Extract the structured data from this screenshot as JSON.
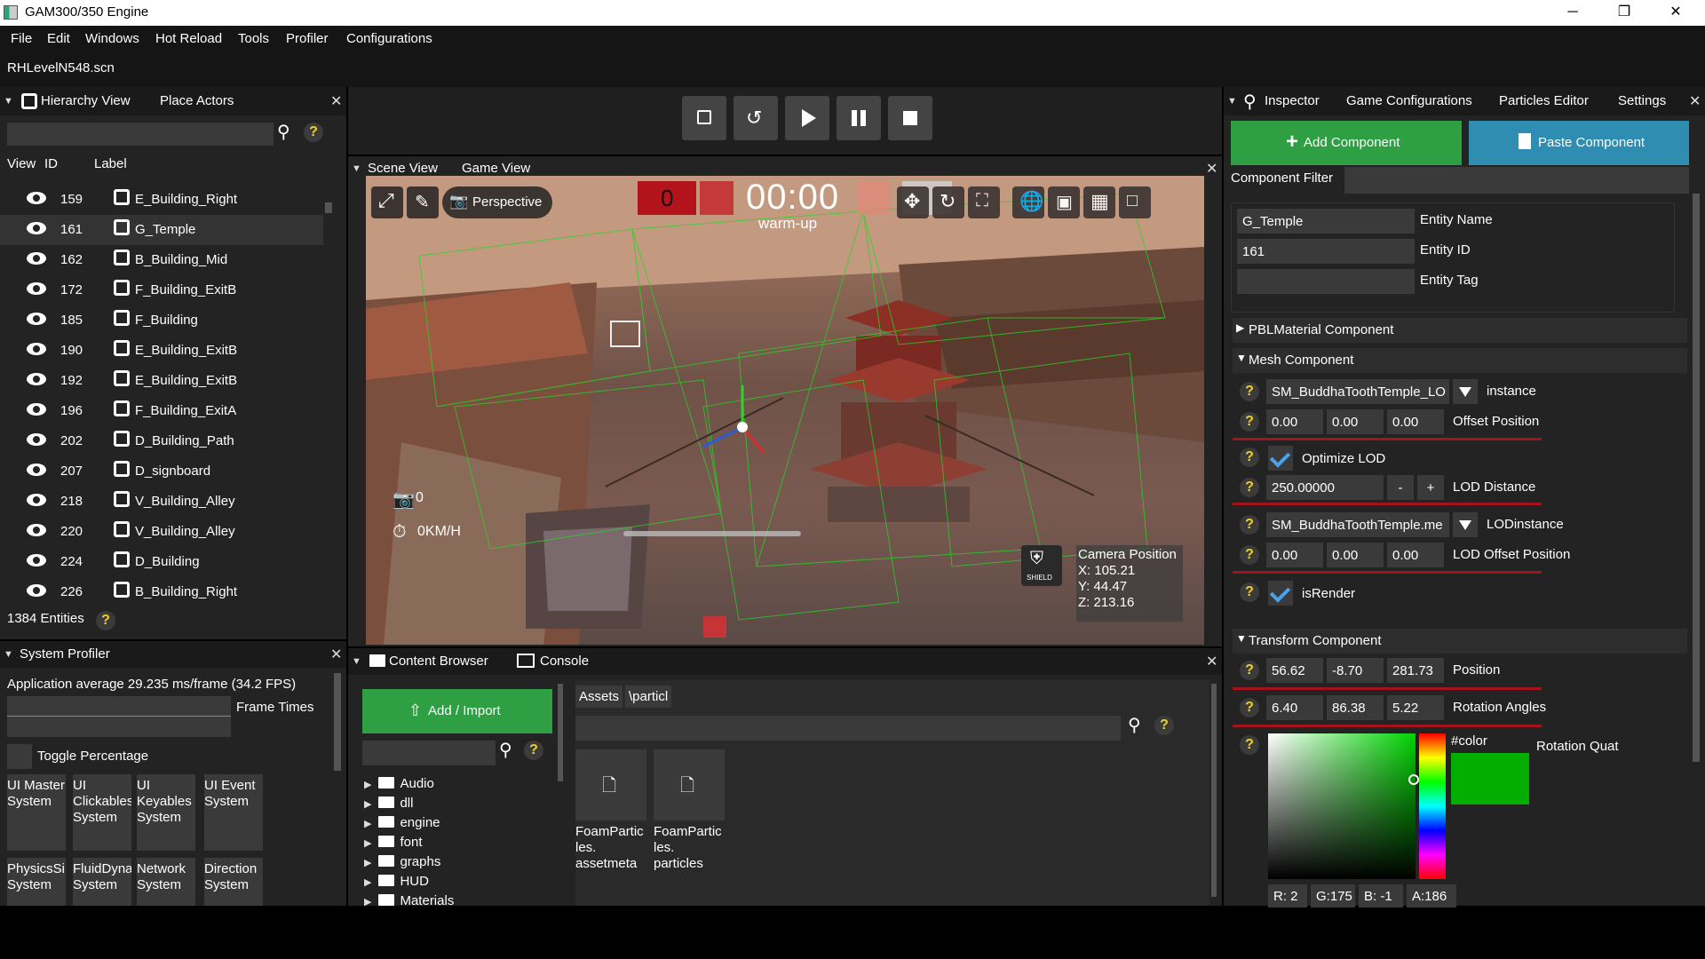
{
  "window": {
    "title": "GAM300/350 Engine",
    "minimize": "─",
    "maximize": "❐",
    "close": "✕"
  },
  "menu": [
    "File",
    "Edit",
    "Windows",
    "Hot Reload",
    "Tools",
    "Profiler",
    "Configurations"
  ],
  "scene_file": "RHLevelN548.scn",
  "hierarchy": {
    "tabs": [
      "Hierarchy View",
      "Place Actors"
    ],
    "columns": {
      "view": "View",
      "id": "ID",
      "label": "Label"
    },
    "rows": [
      {
        "id": "159",
        "label": "E_Building_Right"
      },
      {
        "id": "161",
        "label": "G_Temple"
      },
      {
        "id": "162",
        "label": "B_Building_Mid"
      },
      {
        "id": "172",
        "label": "F_Building_ExitB"
      },
      {
        "id": "185",
        "label": "F_Building"
      },
      {
        "id": "190",
        "label": "E_Building_ExitB"
      },
      {
        "id": "192",
        "label": "E_Building_ExitB"
      },
      {
        "id": "196",
        "label": "F_Building_ExitA"
      },
      {
        "id": "202",
        "label": "D_Building_Path"
      },
      {
        "id": "207",
        "label": "D_signboard"
      },
      {
        "id": "218",
        "label": "V_Building_Alley"
      },
      {
        "id": "220",
        "label": "V_Building_Alley"
      },
      {
        "id": "224",
        "label": "D_Building"
      },
      {
        "id": "226",
        "label": "B_Building_Right"
      }
    ],
    "entities_count": "1384 Entities"
  },
  "profiler": {
    "title": "System Profiler",
    "average": "Application average 29.235 ms/frame (34.2 FPS)",
    "frame_times": "Frame Times",
    "toggle": "Toggle Percentage",
    "systems": [
      "UI Master System",
      "UI Clickables System",
      "UI Keyables System",
      "UI Event System",
      "PhysicsSimulation System",
      "FluidDynamics System",
      "Network System",
      "Direction System"
    ]
  },
  "scene": {
    "tabs": [
      "Scene View",
      "Game View"
    ],
    "perspective": "Perspective",
    "score": "0",
    "timer": "00:00",
    "warmup": "warm-up",
    "camera_count": "0",
    "speed": "0KM/H",
    "shield": "SHIELD",
    "camera": {
      "title": "Camera Position",
      "x": "X: 105.21",
      "y": "Y: 44.47",
      "z": "Z: 213.16"
    }
  },
  "content": {
    "tabs": [
      "Content Browser",
      "Console"
    ],
    "add_import": "Add / Import",
    "path": [
      "Assets",
      "\\particl"
    ],
    "folders": [
      "Audio",
      "dll",
      "engine",
      "font",
      "graphs",
      "HUD",
      "Materials"
    ],
    "files": [
      {
        "name": "FoamParticles.assetmeta",
        "lines": [
          "FoamPartic",
          "les.",
          "assetmeta"
        ]
      },
      {
        "name": "FoamParticles.particles",
        "lines": [
          "FoamPartic",
          "les.",
          "particles"
        ]
      }
    ]
  },
  "inspector": {
    "tabs": [
      "Inspector",
      "Game Configurations",
      "Particles Editor",
      "Settings"
    ],
    "add_component": "Add Component",
    "paste_component": "Paste Component",
    "component_filter": "Component Filter",
    "entity": {
      "name": "G_Temple",
      "name_label": "Entity Name",
      "id": "161",
      "id_label": "Entity ID",
      "tag": "",
      "tag_label": "Entity Tag"
    },
    "pbl": "PBLMaterial Component",
    "mesh": {
      "title": "Mesh Component",
      "instance_value": "SM_BuddhaToothTemple_LO",
      "instance_label": "instance",
      "offset": [
        "0.00",
        "0.00",
        "0.00"
      ],
      "offset_label": "Offset Position",
      "optimize_lod": "Optimize LOD",
      "lod_distance": "250.00000",
      "lod_distance_label": "LOD Distance",
      "minus": "-",
      "plus": "+",
      "lod_instance": "SM_BuddhaToothTemple.me",
      "lod_instance_label": "LODinstance",
      "lod_offset": [
        "0.00",
        "0.00",
        "0.00"
      ],
      "lod_offset_label": "LOD Offset Position",
      "is_render": "isRender"
    },
    "transform": {
      "title": "Transform Component",
      "position": [
        "56.62",
        "-8.70",
        "281.73"
      ],
      "position_label": "Position",
      "rotation": [
        "6.40",
        "86.38",
        "5.22"
      ],
      "rotation_label": "Rotation Angles",
      "quat_label": "Rotation Quat",
      "color_label": "#color",
      "rgba": [
        "R: 2",
        "G:175",
        "B: -1",
        "A:186"
      ],
      "swatch": "#02af00"
    }
  },
  "colors": {
    "green": "#2ea043",
    "teal": "#2e8db0",
    "red": "#a3131b"
  }
}
